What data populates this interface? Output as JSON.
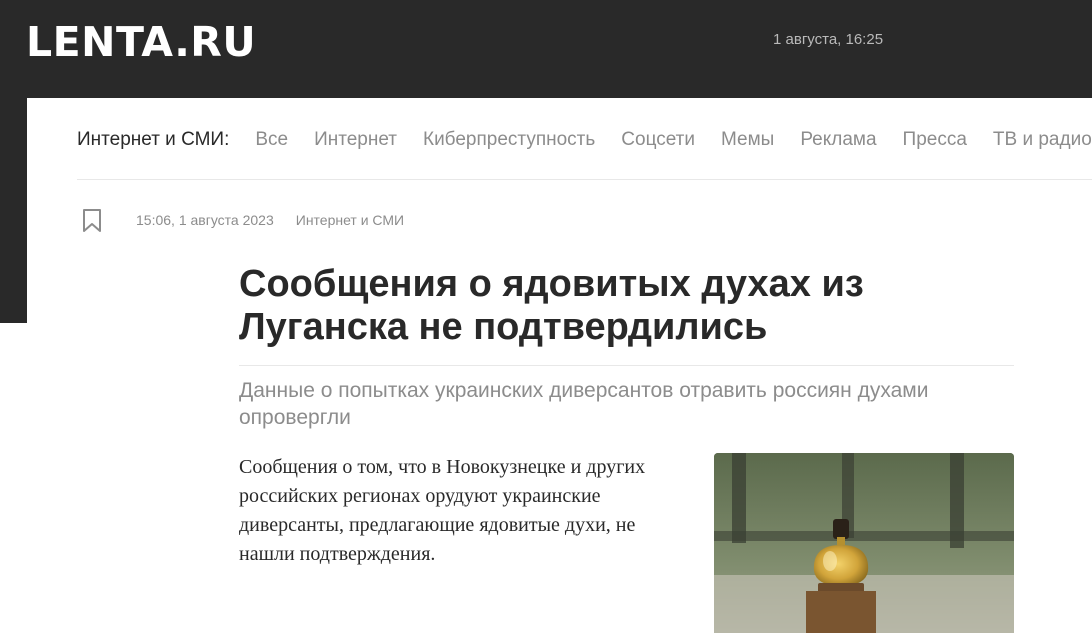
{
  "header": {
    "logo": "LENTA.RU",
    "datetime": "1 августа, 16:25"
  },
  "rubric_nav": {
    "title": "Интернет и СМИ:",
    "items": [
      "Все",
      "Интернет",
      "Киберпреступность",
      "Соцсети",
      "Мемы",
      "Реклама",
      "Пресса",
      "ТВ и радио"
    ]
  },
  "article": {
    "timestamp": "15:06, 1 августа 2023",
    "rubric": "Интернет и СМИ",
    "title": "Сообщения о ядовитых духах из Луганска не подтвердились",
    "subtitle": "Данные о попытках украинских диверсантов отравить россиян духами опровергли",
    "lead": "Сообщения о том, что в Новокузнецке и других российских регионах орудуют украинские диверсанты, предлагающие ядовитые духи, не нашли подтверждения.",
    "image_icon": "perfume-bottle-photo"
  },
  "icons": {
    "bookmark": "bookmark-icon"
  },
  "colors": {
    "header_bg": "#292929",
    "text_primary": "#292929",
    "text_muted": "#8c8c8c",
    "divider": "#e8e8e8"
  }
}
